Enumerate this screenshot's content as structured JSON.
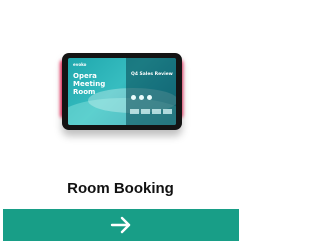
{
  "card": {
    "title": "Room Booking",
    "action_icon": "arrow-right-icon"
  },
  "device_screen": {
    "logo": "evoko",
    "title": "Opera Meeting Room",
    "meeting": "Q4 Sales Review"
  },
  "colors": {
    "accent": "#189e87",
    "edge_light": "#ff2f63",
    "screen": "#2aa4b2"
  }
}
